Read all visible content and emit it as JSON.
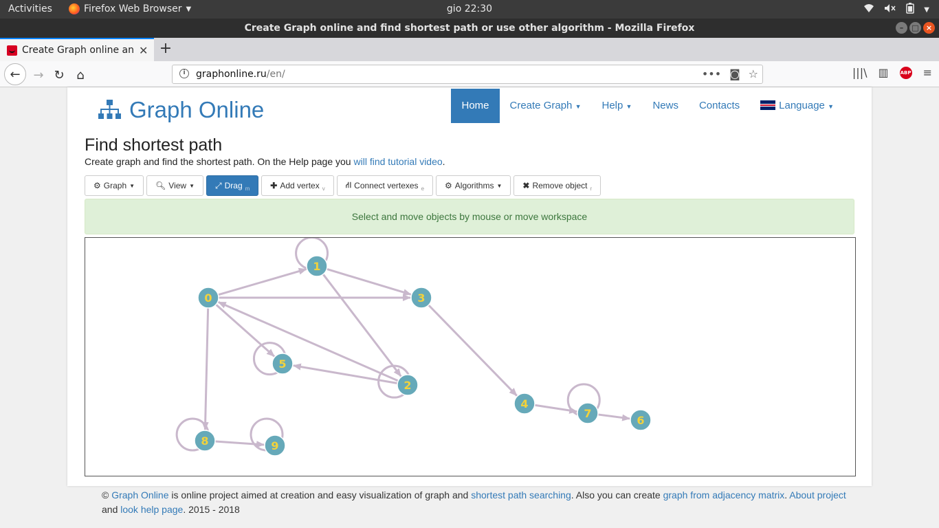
{
  "system": {
    "activities": "Activities",
    "app_name": "Firefox Web Browser",
    "clock": "gio 22:30"
  },
  "window": {
    "title": "Create Graph online and find shortest path or use other algorithm - Mozilla Firefox"
  },
  "browser": {
    "tab_title": "Create Graph online and",
    "url_host": "graphonline.ru",
    "url_path": "/en/"
  },
  "site": {
    "brand": "Graph Online",
    "nav": [
      {
        "label": "Home",
        "active": true
      },
      {
        "label": "Create Graph",
        "dropdown": true
      },
      {
        "label": "Help",
        "dropdown": true
      },
      {
        "label": "News"
      },
      {
        "label": "Contacts"
      },
      {
        "label": "Language",
        "dropdown": true
      }
    ],
    "page_title": "Find shortest path",
    "subtitle_text": "Create graph and find the shortest path. On the Help page you",
    "subtitle_link": "will find tutorial video",
    "subtitle_end": "."
  },
  "toolbar": {
    "graph": "Graph",
    "view": "View",
    "drag": "Drag",
    "drag_key": "m",
    "add_vertex": "Add vertex",
    "add_vertex_key": "v",
    "connect": "Connect vertexes",
    "connect_key": "e",
    "algorithms": "Algorithms",
    "remove": "Remove object",
    "remove_key": "r"
  },
  "alert": "Select and move objects by mouse or move workspace",
  "graph": {
    "vertex_color": "#66a9b9",
    "label_color": "#f2d23c",
    "edge_color": "#c9b8cc",
    "vertices": [
      {
        "id": "0"
      },
      {
        "id": "1"
      },
      {
        "id": "2"
      },
      {
        "id": "3"
      },
      {
        "id": "4"
      },
      {
        "id": "5"
      },
      {
        "id": "6"
      },
      {
        "id": "7"
      },
      {
        "id": "8"
      },
      {
        "id": "9"
      }
    ],
    "edges": [
      {
        "from": "0",
        "to": "1"
      },
      {
        "from": "0",
        "to": "3"
      },
      {
        "from": "1",
        "to": "3"
      },
      {
        "from": "1",
        "to": "2"
      },
      {
        "from": "0",
        "to": "5"
      },
      {
        "from": "2",
        "to": "0"
      },
      {
        "from": "2",
        "to": "5"
      },
      {
        "from": "0",
        "to": "8"
      },
      {
        "from": "8",
        "to": "9"
      },
      {
        "from": "3",
        "to": "4"
      },
      {
        "from": "4",
        "to": "7"
      },
      {
        "from": "7",
        "to": "6"
      }
    ],
    "loops": [
      "1",
      "5",
      "2",
      "8",
      "9",
      "7"
    ]
  },
  "footer": {
    "copyright": "©",
    "link1": "Graph Online",
    "text1": " is online project aimed at creation and easy visualization of graph and ",
    "link2": "shortest path searching",
    "text2": ". Also you can create ",
    "link3": "graph from adjacency matrix",
    "text3": ". ",
    "link4": "About project",
    "text4": " and ",
    "link5": "look help page",
    "text5": ". 2015 - 2018"
  }
}
